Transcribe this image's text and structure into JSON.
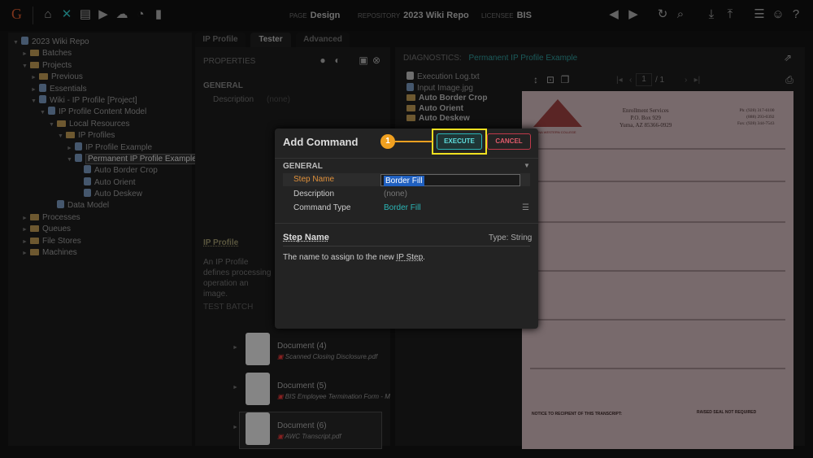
{
  "header": {
    "logo": "G",
    "nav_icons": [
      "home-icon",
      "tools-icon",
      "archive-icon",
      "batch-play-icon",
      "cloud-upload-icon",
      "schedule-icon",
      "chart-icon"
    ],
    "page_label": "PAGE",
    "page": "Design",
    "repo_label": "REPOSITORY",
    "repo": "2023 Wiki Repo",
    "licensee_label": "LICENSEE",
    "licensee": "BIS"
  },
  "tree": [
    {
      "label": "2023 Wiki Repo",
      "level": 0,
      "type": "repo",
      "exp": "▼"
    },
    {
      "label": "Batches",
      "level": 1,
      "type": "folder",
      "exp": "►"
    },
    {
      "label": "Projects",
      "level": 1,
      "type": "folder",
      "exp": "▼"
    },
    {
      "label": "Previous",
      "level": 2,
      "type": "folder",
      "exp": "►"
    },
    {
      "label": "Essentials",
      "level": 2,
      "type": "item",
      "exp": "►"
    },
    {
      "label": "Wiki - IP Profile [Project]",
      "level": 2,
      "type": "item",
      "exp": "▼"
    },
    {
      "label": "IP Profile Content Model",
      "level": 3,
      "type": "item",
      "exp": "▼"
    },
    {
      "label": "Local Resources",
      "level": 4,
      "type": "folder",
      "exp": "▼"
    },
    {
      "label": "IP Profiles",
      "level": 5,
      "type": "folder",
      "exp": "▼"
    },
    {
      "label": "IP Profile Example",
      "level": 6,
      "type": "item",
      "exp": "►"
    },
    {
      "label": "Permanent IP Profile Example",
      "level": 6,
      "type": "item",
      "exp": "▼",
      "selected": true
    },
    {
      "label": "Auto Border Crop",
      "level": 7,
      "type": "item",
      "exp": ""
    },
    {
      "label": "Auto Orient",
      "level": 7,
      "type": "item",
      "exp": ""
    },
    {
      "label": "Auto Deskew",
      "level": 7,
      "type": "item",
      "exp": ""
    },
    {
      "label": "Data Model",
      "level": 4,
      "type": "item",
      "exp": ""
    },
    {
      "label": "Processes",
      "level": 1,
      "type": "folder",
      "exp": "►"
    },
    {
      "label": "Queues",
      "level": 1,
      "type": "folder",
      "exp": "►"
    },
    {
      "label": "File Stores",
      "level": 1,
      "type": "folder",
      "exp": "►"
    },
    {
      "label": "Machines",
      "level": 1,
      "type": "folder",
      "exp": "►"
    }
  ],
  "tabs": [
    "IP Profile",
    "Tester",
    "Advanced"
  ],
  "properties": {
    "title": "PROPERTIES",
    "general": "GENERAL",
    "desc_label": "Description",
    "desc_value": "(none)",
    "help_title": "IP Profile",
    "help_text": "An IP Profile defines processing operation an image.",
    "test_batch": "TEST BATCH"
  },
  "documents": [
    {
      "name": "Document (4)",
      "file": "Scanned Closing Disclosure.pdf"
    },
    {
      "name": "Document (5)",
      "file": "BIS Employee Termination Form - M"
    },
    {
      "name": "Document (6)",
      "file": "AWC Transcript.pdf"
    }
  ],
  "diagnostics": {
    "label": "DIAGNOSTICS:",
    "name": "Permanent IP Profile Example",
    "files": [
      {
        "label": "Execution Log.txt",
        "type": "file"
      },
      {
        "label": "Input Image.jpg",
        "type": "image"
      },
      {
        "label": "Auto Border Crop",
        "type": "folder"
      },
      {
        "label": "Auto Orient",
        "type": "folder"
      },
      {
        "label": "Auto Deskew",
        "type": "folder"
      }
    ],
    "page": "1",
    "pages": "/ 1"
  },
  "document_preview": {
    "org": "Enrollment Services",
    "addr1": "P.O. Box 929",
    "addr2": "Yuma, AZ 85366-0929",
    "phone": "Ph: (928) 317-6100",
    "phone2": "(888) 293-0392",
    "fax": "Fax: (928) 344-7543",
    "school": "ARIZONA WESTERN COLLEGE",
    "notice": "NOTICE TO RECIPIENT OF THIS TRANSCRIPT:",
    "seal": "RAISED SEAL NOT REQUIRED"
  },
  "dialog": {
    "title": "Add Command",
    "execute": "EXECUTE",
    "cancel": "CANCEL",
    "section": "GENERAL",
    "fields": [
      {
        "label": "Step Name",
        "value": "Border Fill"
      },
      {
        "label": "Description",
        "value": "(none)"
      },
      {
        "label": "Command Type",
        "value": "Border Fill"
      }
    ],
    "help_title": "Step Name",
    "help_type": "Type: String",
    "help_text": "The name to assign to the new ",
    "help_link": "IP Step",
    "help_end": ".",
    "callout": "1"
  },
  "colors": {
    "accent": "#2bb5b5",
    "cancel": "#c0394a",
    "callout": "#f0a020",
    "highlight": "#f0e020"
  }
}
